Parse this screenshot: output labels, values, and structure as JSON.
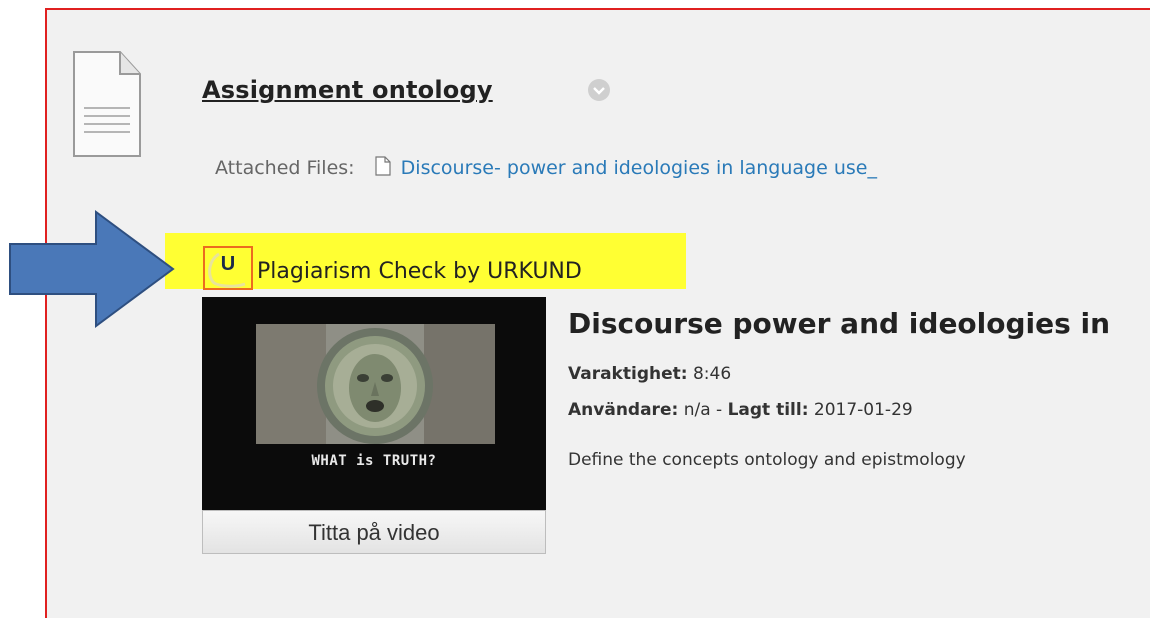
{
  "assignment": {
    "title": "Assignment ontology",
    "attached_label": "Attached Files:",
    "file_link": "Discourse- power and ideologies in language use_"
  },
  "plagiarism": {
    "icon_letter": "U",
    "label": "Plagiarism Check by URKUND"
  },
  "video": {
    "thumbnail_caption": "WHAT is TRUTH?",
    "watch_label": "Titta på video",
    "title": "Discourse power and ideologies in",
    "duration_label": "Varaktighet:",
    "duration_value": "8:46",
    "user_label": "Användare:",
    "user_value": "n/a",
    "separator": "-",
    "added_label": "Lagt till:",
    "added_value": "2017-01-29",
    "description": "Define the concepts ontology and epistmology"
  },
  "colors": {
    "highlight": "#ffff33",
    "link": "#2a7ab8",
    "arrow": "#4a78b8",
    "urkund_border": "#ec6b1f",
    "panel_border": "#e02020"
  }
}
